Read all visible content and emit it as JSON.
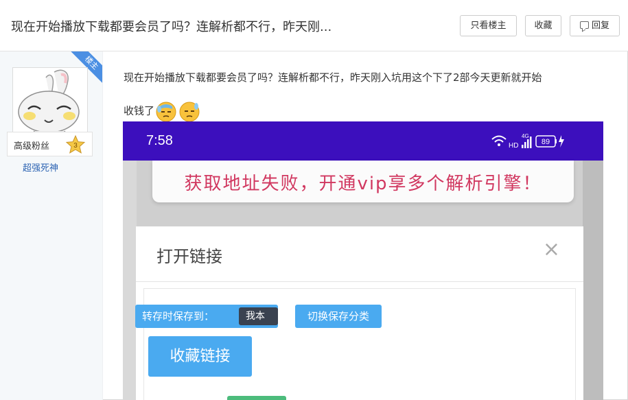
{
  "header": {
    "title": "现在开始播放下载都要会员了吗？连解析都不行，昨天刚...",
    "buttons": {
      "only_op": "只看楼主",
      "favorite": "收藏",
      "reply": "回复"
    }
  },
  "author": {
    "badge": "楼主",
    "name": "超强死神",
    "level_title": "高级粉丝",
    "level": "3"
  },
  "post": {
    "line1": "现在开始播放下载都要会员了吗？连解析都不行，昨天刚入坑用这个下了2部今天更新就开始",
    "line2": "收钱了",
    "emoji": [
      "sweat-face-icon",
      "sweat-face-icon"
    ]
  },
  "screenshot": {
    "time": "7:58",
    "network": "4G",
    "hd": "HD",
    "battery": "89",
    "toast": "获取地址失败，开通vip享多个解析引擎！",
    "dialog_title": "打开链接",
    "close_symbol": "×",
    "save_to_label": "转存时保存到：",
    "save_to_value": "我本初",
    "switch_category": "切换保存分类",
    "collect_link": "收藏链接"
  },
  "colors": {
    "status_bar": "#3c0fbd",
    "toast_text": "#d13860",
    "chip_blue": "#4aaaf0",
    "username_blue": "#2d64b3",
    "ribbon": "#4b8fe3"
  }
}
